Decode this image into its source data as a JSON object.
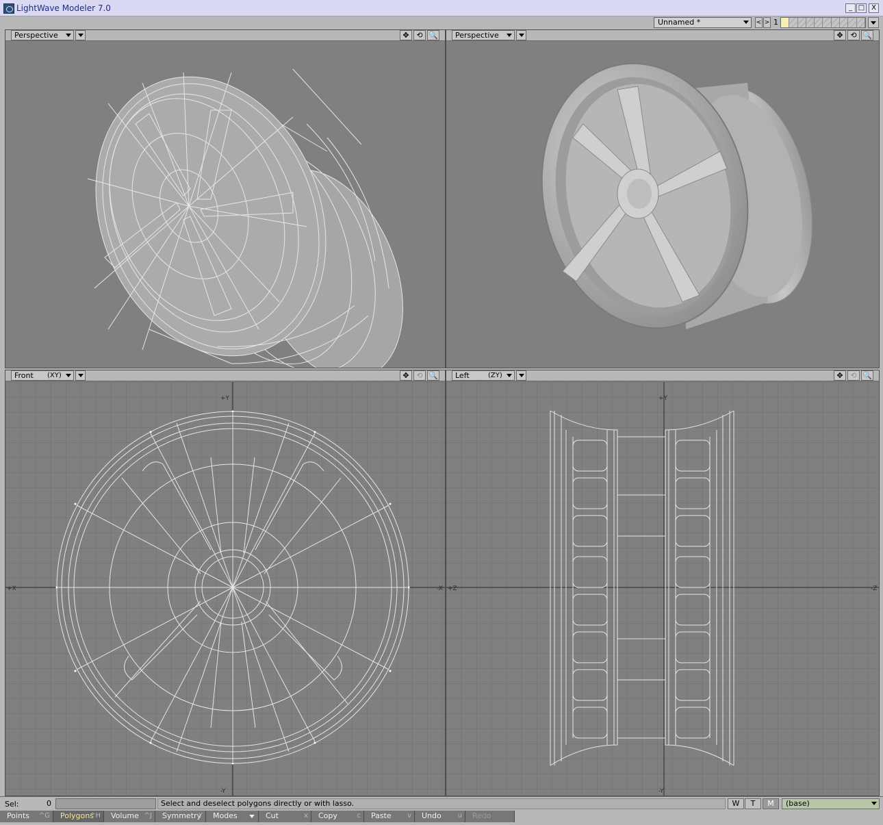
{
  "window": {
    "title": "LightWave Modeler 7.0",
    "controls": {
      "minimize": "_",
      "maximize": "□",
      "close": "X"
    }
  },
  "topbar": {
    "object_name": "Unnamed *",
    "prev_label": "<",
    "next_label": ">",
    "layer_number": "1"
  },
  "viewports": {
    "top_left": {
      "view": "Perspective",
      "axis": ""
    },
    "top_right": {
      "view": "Perspective",
      "axis": ""
    },
    "bottom_left": {
      "view": "Front",
      "axis": "(XY)",
      "axis_labels": {
        "up": "+Y",
        "down": "-Y",
        "left": "+X",
        "right": "-X"
      }
    },
    "bottom_right": {
      "view": "Left",
      "axis": "(ZY)",
      "axis_labels": {
        "up": "+Y",
        "down": "-Y",
        "left": "+Z",
        "right": "-Z"
      }
    }
  },
  "viewport_tools": {
    "move": "✥",
    "rotate": "⟲",
    "zoom": "🔍"
  },
  "infobar": {
    "sel_label": "Sel:",
    "sel_count": "0",
    "status": "Select and deselect polygons directly or with lasso.",
    "w_label": "W",
    "t_label": "T",
    "m_label": "M",
    "layer": "(base)"
  },
  "cmdbar": [
    {
      "label": "Points",
      "key": "^G"
    },
    {
      "label": "Polygons",
      "key": "^H",
      "active": true
    },
    {
      "label": "Volume",
      "key": "^J"
    },
    {
      "label": "Symmetry",
      "key": "Y"
    },
    {
      "label": "Modes",
      "key": ""
    },
    {
      "label": "Cut",
      "key": "x"
    },
    {
      "label": "Copy",
      "key": "c"
    },
    {
      "label": "Paste",
      "key": "v"
    },
    {
      "label": "Undo",
      "key": "u"
    },
    {
      "label": "Redo",
      "key": "",
      "disabled": true
    }
  ],
  "colors": {
    "viewport_bg": "#808080",
    "wire": "#e6e6e6",
    "grid": "#6e6e6e",
    "axis": "#2a2a2a",
    "active_cmd": "#f2e690"
  }
}
